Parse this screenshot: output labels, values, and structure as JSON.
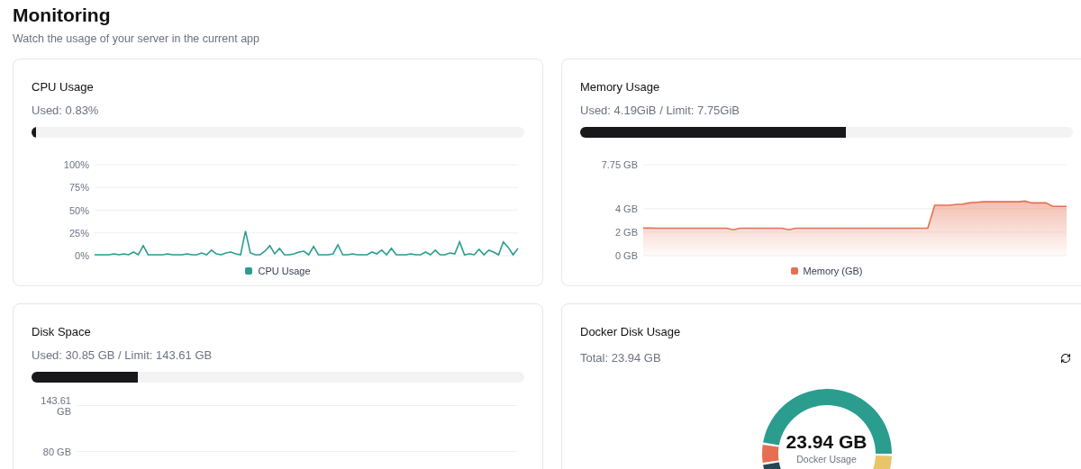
{
  "header": {
    "title": "Monitoring",
    "subtitle": "Watch the usage of your server in the current app"
  },
  "cpu": {
    "title": "CPU Usage",
    "used": "Used: 0.83%",
    "level": 0.0083,
    "chart_data": {
      "type": "line",
      "grid": true,
      "ylim": [
        0,
        100
      ],
      "yticks": [
        {
          "value": 0,
          "label": "0%"
        },
        {
          "value": 25,
          "label": "25%"
        },
        {
          "value": 50,
          "label": "50%"
        },
        {
          "value": 75,
          "label": "75%"
        },
        {
          "value": 100,
          "label": "100%"
        }
      ],
      "series": [
        {
          "name": "CPU Usage",
          "color": "#2a9d8f",
          "values": [
            1,
            1,
            1,
            1,
            2,
            1,
            2,
            1,
            4,
            1,
            11,
            1,
            1,
            1,
            1,
            2,
            1,
            1,
            1,
            2,
            1,
            1,
            3,
            1,
            6,
            2,
            1,
            3,
            4,
            2,
            1,
            27,
            3,
            1,
            1,
            5,
            11,
            2,
            8,
            1,
            1,
            2,
            4,
            5,
            1,
            10,
            1,
            1,
            1,
            2,
            12,
            1,
            1,
            2,
            1,
            1,
            1,
            4,
            2,
            6,
            1,
            8,
            1,
            1,
            1,
            2,
            1,
            1,
            4,
            1,
            6,
            1,
            1,
            3,
            2,
            15,
            1,
            2,
            1,
            7,
            1,
            6,
            4,
            1,
            15,
            9,
            1,
            8
          ]
        }
      ]
    }
  },
  "memory": {
    "title": "Memory Usage",
    "used": "Used: 4.19GiB / Limit: 7.75GiB",
    "level": 0.54,
    "chart_data": {
      "type": "area",
      "grid": true,
      "ylim": [
        0,
        7.75
      ],
      "yticks": [
        {
          "value": 0,
          "label": "0 GB"
        },
        {
          "value": 2,
          "label": "2 GB"
        },
        {
          "value": 4,
          "label": "4 GB"
        },
        {
          "value": 7.75,
          "label": "7.75 GB"
        }
      ],
      "series": [
        {
          "name": "Memory (GB)",
          "color": "#e76f51",
          "values": [
            2.35,
            2.35,
            2.34,
            2.34,
            2.34,
            2.34,
            2.34,
            2.34,
            2.34,
            2.34,
            2.34,
            2.34,
            2.34,
            2.2,
            2.34,
            2.34,
            2.34,
            2.34,
            2.34,
            2.34,
            2.34,
            2.2,
            2.34,
            2.34,
            2.34,
            2.34,
            2.34,
            2.34,
            2.34,
            2.34,
            2.34,
            2.34,
            2.34,
            2.34,
            2.34,
            2.34,
            2.34,
            2.34,
            2.34,
            2.34,
            2.34,
            2.34,
            4.3,
            4.3,
            4.3,
            4.35,
            4.4,
            4.5,
            4.55,
            4.6,
            4.6,
            4.6,
            4.6,
            4.6,
            4.6,
            4.65,
            4.5,
            4.5,
            4.5,
            4.2,
            4.2,
            4.2
          ]
        }
      ]
    }
  },
  "disk": {
    "title": "Disk Space",
    "used": "Used: 30.85 GB / Limit: 143.61 GB",
    "level": 0.215,
    "y_axis_labels": [
      "143.61 GB",
      "80 GB"
    ]
  },
  "docker": {
    "title": "Docker Disk Usage",
    "total": "Total: 23.94 GB",
    "center_value": "23.94 GB",
    "center_label": "Docker Usage"
  }
}
